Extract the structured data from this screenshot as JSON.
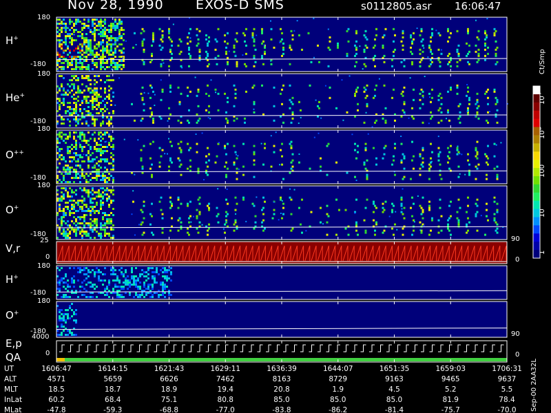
{
  "header": {
    "date": "Nov 28, 1990",
    "mission": "EXOS-D SMS",
    "file": "s0112805.asr",
    "time": "16:06:47"
  },
  "panels": [
    {
      "id": "h",
      "name": "H",
      "sup": "+",
      "ymax": "180",
      "ymin": "-180"
    },
    {
      "id": "he",
      "name": "He",
      "sup": "+",
      "ymax": "180",
      "ymin": "-180"
    },
    {
      "id": "opp",
      "name": "O",
      "sup": "++",
      "ymax": "180",
      "ymin": "-180"
    },
    {
      "id": "op",
      "name": "O",
      "sup": "+",
      "ymax": "180",
      "ymin": "-180"
    },
    {
      "id": "vr",
      "name": "V,r",
      "ymax": "25",
      "ymin": "0",
      "right_top": "90",
      "right_bottom": "0"
    },
    {
      "id": "h2",
      "name": "H",
      "sup": "+",
      "ymax": "180",
      "ymin": "-180"
    },
    {
      "id": "o2",
      "name": "O",
      "sup": "+",
      "ymax": "180",
      "ymin": "-180",
      "right_bottom": "90"
    },
    {
      "id": "ep",
      "name": "E,p",
      "name2": "QA",
      "ymax": "4000",
      "ymin": "0",
      "right_bottom": "0"
    }
  ],
  "colorbar": {
    "unit": "Ct/Smp",
    "ticks": [
      "10",
      "10",
      "10",
      "100",
      "10",
      "1"
    ],
    "ticks_sup": [
      "4",
      "3",
      "",
      "",
      "",
      ""
    ],
    "colors": [
      "#00007a",
      "#0000a8",
      "#0000d8",
      "#0048ff",
      "#0090ff",
      "#00c8e0",
      "#00e8b0",
      "#20f060",
      "#30d830",
      "#70e000",
      "#b0e800",
      "#e8f000",
      "#f8d800",
      "#c8b000",
      "#b08000",
      "#a86000",
      "#e00000",
      "#c00000",
      "#880000",
      "#600000",
      "#ffffff"
    ]
  },
  "footer": {
    "row_labels": [
      "UT",
      "ALT",
      "MLT",
      "InLat",
      "MLat"
    ],
    "columns": [
      [
        "1606:47",
        "4571",
        "18.5",
        "60.2",
        "-47.8"
      ],
      [
        "1614:15",
        "5659",
        "18.7",
        "68.4",
        "-59.3"
      ],
      [
        "1621:43",
        "6626",
        "18.9",
        "75.1",
        "-68.8"
      ],
      [
        "1629:11",
        "7462",
        "19.4",
        "80.8",
        "-77.0"
      ],
      [
        "1636:39",
        "8163",
        "20.8",
        "85.0",
        "-83.8"
      ],
      [
        "1644:07",
        "8729",
        "1.9",
        "85.0",
        "-86.2"
      ],
      [
        "1651:35",
        "9163",
        "4.5",
        "85.0",
        "-81.4"
      ],
      [
        "1659:03",
        "9465",
        "5.2",
        "81.9",
        "-75.7"
      ],
      [
        "1706:31",
        "9637",
        "5.5",
        "78.4",
        "-70.0"
      ]
    ],
    "side_label": "Sep-00 2AA32L"
  },
  "chart_data": {
    "type": "heatmap",
    "x_axis_label": "UT",
    "x_ticks": [
      "1606:47",
      "1614:15",
      "1621:43",
      "1629:11",
      "1636:39",
      "1644:07",
      "1651:35",
      "1659:03",
      "1706:31"
    ],
    "colorbar_label": "Ct/Smp",
    "colorbar_scale": "log",
    "colorbar_range": [
      1,
      10000
    ],
    "panels": [
      {
        "name": "H+",
        "y_range": [
          -180,
          180
        ]
      },
      {
        "name": "He+",
        "y_range": [
          -180,
          180
        ]
      },
      {
        "name": "O++",
        "y_range": [
          -180,
          180
        ]
      },
      {
        "name": "O+",
        "y_range": [
          -180,
          180
        ]
      },
      {
        "name": "V,r",
        "y_range": [
          0,
          25
        ],
        "right_axis": [
          0,
          90
        ]
      },
      {
        "name": "H+",
        "y_range": [
          -180,
          180
        ]
      },
      {
        "name": "O+",
        "y_range": [
          -180,
          180
        ]
      },
      {
        "name": "E,p / QA",
        "y_range": [
          0,
          4000
        ]
      }
    ]
  }
}
